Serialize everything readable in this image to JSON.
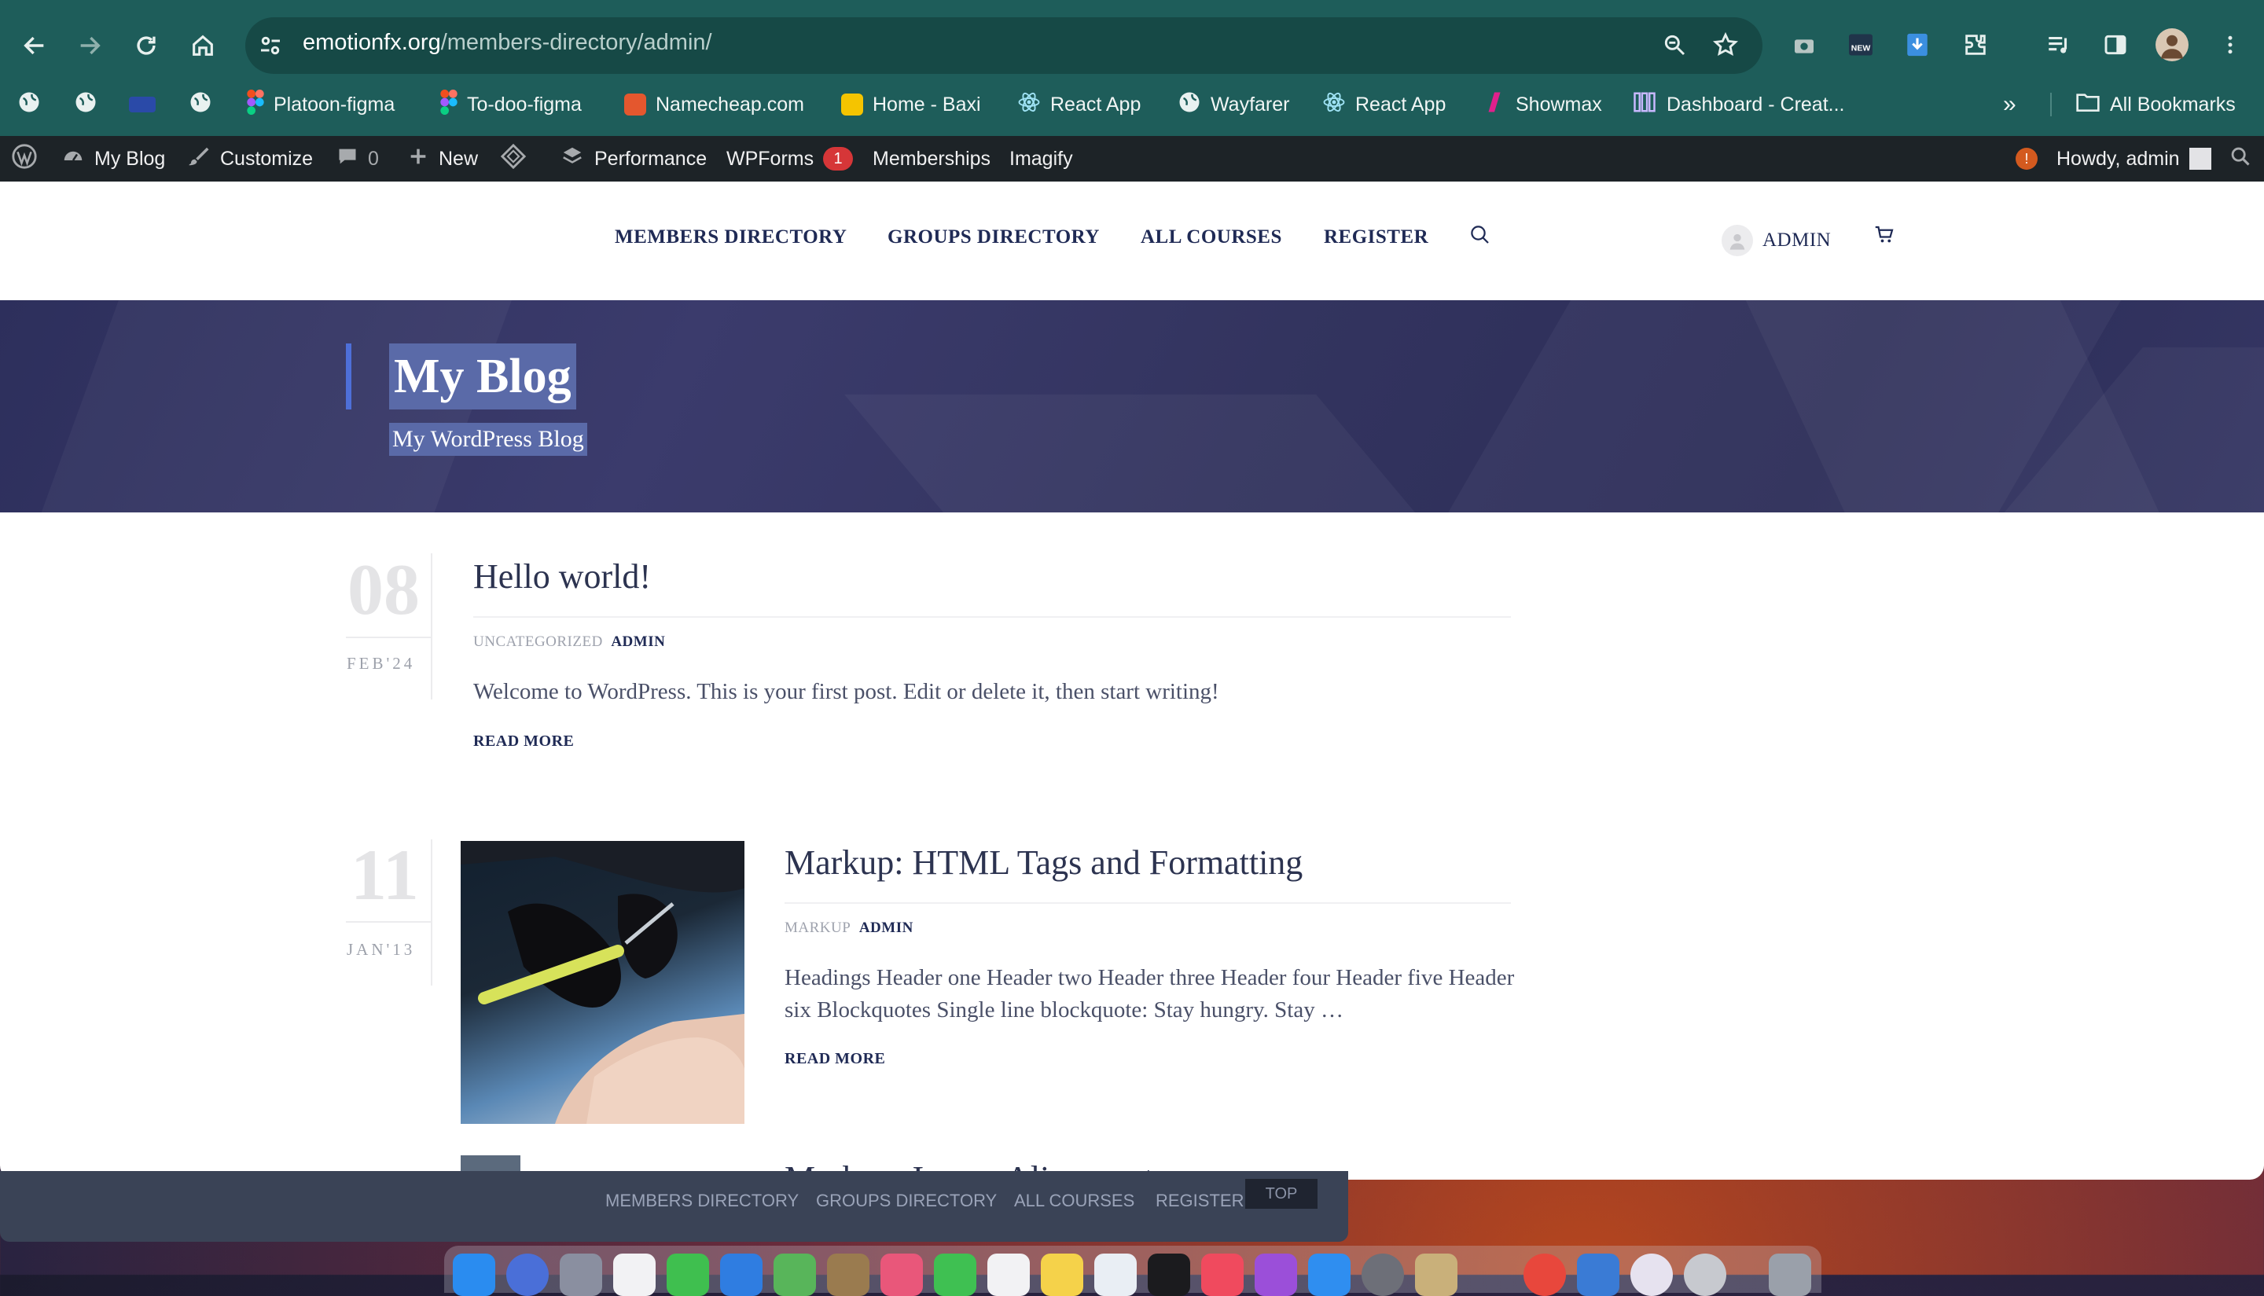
{
  "browser": {
    "url_host": "emotionfx.org",
    "url_path": "/members-directory/admin/",
    "bookmarks": [
      {
        "label": "Platoon-figma"
      },
      {
        "label": "To-doo-figma"
      },
      {
        "label": "Namecheap.com"
      },
      {
        "label": "Home - Baxi"
      },
      {
        "label": "React App"
      },
      {
        "label": "Wayfarer"
      },
      {
        "label": "React App"
      },
      {
        "label": "Showmax"
      },
      {
        "label": "Dashboard - Creat..."
      }
    ],
    "overflow_glyph": "»",
    "all_bookmarks": "All Bookmarks"
  },
  "adminbar": {
    "site": "My Blog",
    "customize": "Customize",
    "comments_count": "0",
    "new": "New",
    "performance": "Performance",
    "wpforms": "WPForms",
    "wpforms_badge": "1",
    "memberships": "Memberships",
    "imagify": "Imagify",
    "notice_badge": "!",
    "howdy": "Howdy, admin"
  },
  "site_nav": {
    "items": [
      "MEMBERS DIRECTORY",
      "GROUPS DIRECTORY",
      "ALL COURSES",
      "REGISTER"
    ],
    "account": "ADMIN"
  },
  "hero": {
    "title": "My Blog",
    "subtitle": "My WordPress Blog"
  },
  "posts": [
    {
      "day": "08",
      "month": "FEB'24",
      "title": "Hello world!",
      "category": "UNCATEGORIZED",
      "author": "ADMIN",
      "excerpt": "Welcome to WordPress. This is your first post. Edit or delete it, then start writing!",
      "read_more": "READ MORE"
    },
    {
      "day": "11",
      "month": "JAN'13",
      "title": "Markup: HTML Tags and Formatting",
      "category": "MARKUP",
      "author": "ADMIN",
      "excerpt": "Headings Header one Header two Header three Header four Header five Header six Blockquotes Single line blockquote: Stay hungry. Stay …",
      "read_more": "READ MORE"
    },
    {
      "title": "Markup: Image Alignment"
    }
  ],
  "background_window": {
    "nav": [
      "MEMBERS DIRECTORY",
      "GROUPS DIRECTORY",
      "ALL COURSES",
      "REGISTER"
    ],
    "top": "TOP"
  },
  "colors": {
    "chrome": "#1e5d5a",
    "adminbar": "#1d2327",
    "nav_text": "#1f2a55",
    "hero_bg": "#33345f",
    "selection": "#5a6aa8"
  }
}
